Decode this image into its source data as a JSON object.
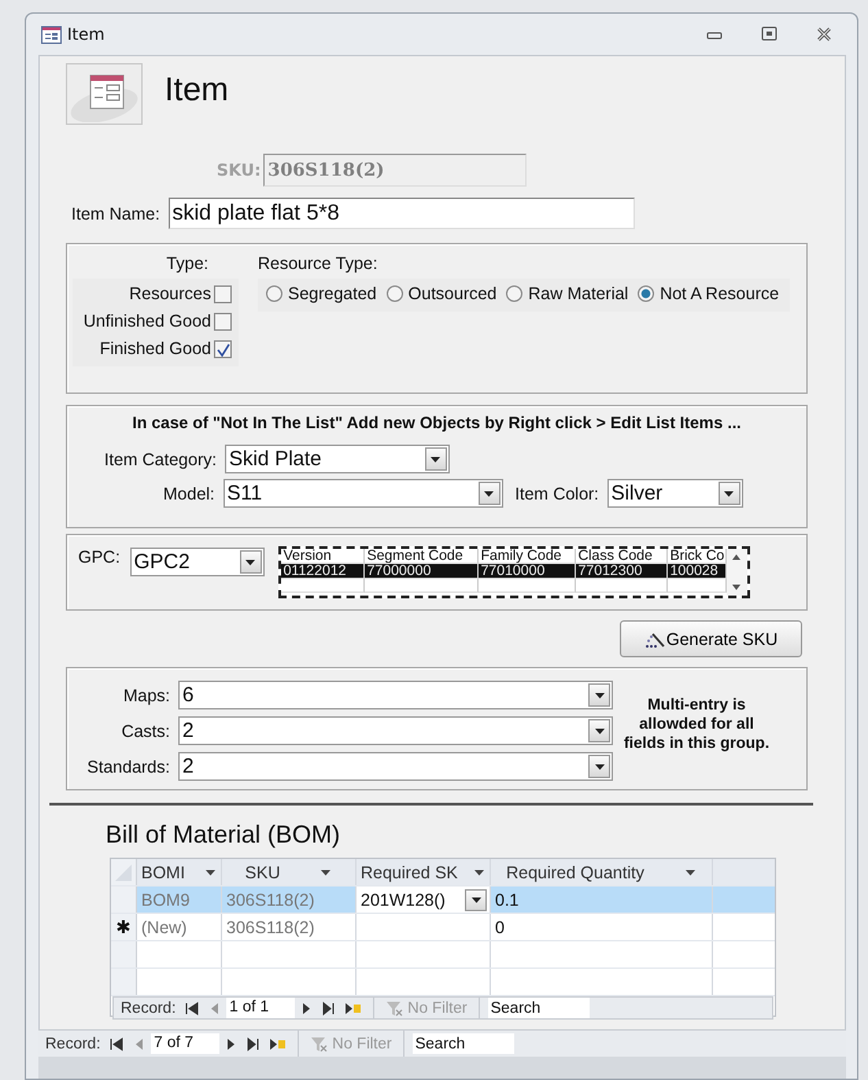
{
  "window": {
    "title": "Item"
  },
  "header": {
    "title": "Item"
  },
  "sku": {
    "label": "SKU:",
    "value": "306S118(2)",
    "disabled": true
  },
  "item_name": {
    "label": "Item Name:",
    "value": "skid plate flat 5*8"
  },
  "type": {
    "label": "Type:",
    "options": [
      {
        "label": "Resources",
        "checked": false
      },
      {
        "label": "Unfinished Good",
        "checked": false
      },
      {
        "label": "Finished Good",
        "checked": true
      }
    ]
  },
  "resource_type": {
    "label": "Resource Type:",
    "options": [
      {
        "label": "Segregated",
        "selected": false
      },
      {
        "label": "Outsourced",
        "selected": false
      },
      {
        "label": "Raw Material",
        "selected": false
      },
      {
        "label": "Not A Resource",
        "selected": true
      }
    ]
  },
  "category": {
    "note": "In case of \"Not In The List\" Add new Objects by Right click > Edit List Items ...",
    "item_category": {
      "label": "Item Category:",
      "value": "Skid Plate"
    },
    "model": {
      "label": "Model:",
      "value": "S11"
    },
    "item_color": {
      "label": "Item Color:",
      "value": "Silver"
    }
  },
  "gpc": {
    "label": "GPC:",
    "value": "GPC2",
    "columns": [
      "Version",
      "Segment Code",
      "Family Code",
      "Class Code",
      "Brick Co"
    ],
    "rows": [
      {
        "cells": [
          "01122012",
          "77000000",
          "77010000",
          "77012300",
          "100028"
        ],
        "selected": true
      }
    ]
  },
  "generate_button": {
    "label": "Generate SKU"
  },
  "multi": {
    "fields": [
      {
        "label": "Maps:",
        "value": "6"
      },
      {
        "label": "Casts:",
        "value": "2"
      },
      {
        "label": "Standards:",
        "value": "2"
      }
    ],
    "note": "Multi-entry is allowded for all fields in this group."
  },
  "bom": {
    "title": "Bill of Material (BOM)",
    "columns": [
      "BOMI",
      "SKU",
      "Required SK",
      "Required Quantity"
    ],
    "rows": [
      {
        "bomid": "BOM9",
        "sku": "306S118(2)",
        "required_sku": "201W128()",
        "required_quantity": "0.1",
        "selected": true
      },
      {
        "marker": "✱",
        "bomid": "(New)",
        "sku": "306S118(2)",
        "required_quantity": "0",
        "selected": false
      }
    ],
    "navigator": {
      "label": "Record:",
      "position": "1 of 1",
      "filter": "No Filter",
      "search_placeholder": "Search"
    }
  },
  "navigator": {
    "label": "Record:",
    "position": "7 of 7",
    "filter": "No Filter",
    "search_placeholder": "Search"
  }
}
